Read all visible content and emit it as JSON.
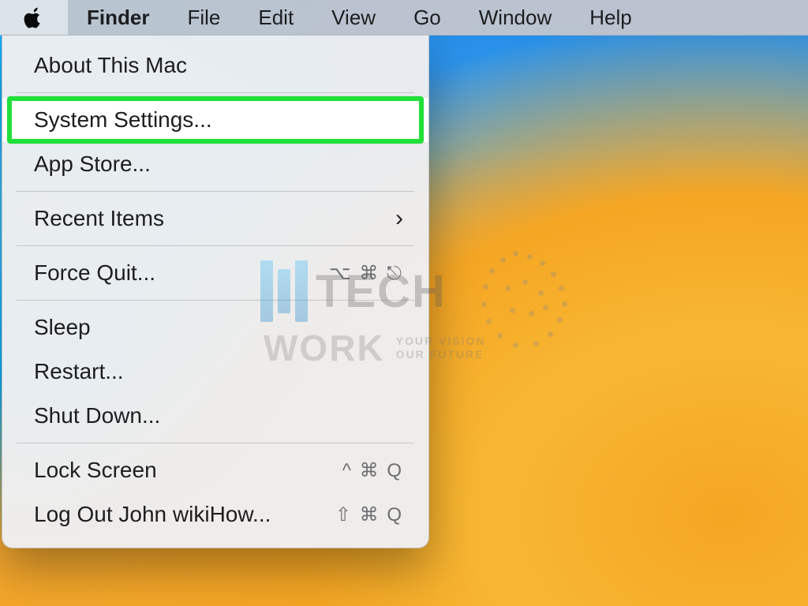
{
  "menubar": {
    "app_name": "Finder",
    "items": [
      {
        "label": "File"
      },
      {
        "label": "Edit"
      },
      {
        "label": "View"
      },
      {
        "label": "Go"
      },
      {
        "label": "Window"
      },
      {
        "label": "Help"
      }
    ]
  },
  "apple_menu": {
    "about": "About This Mac",
    "system_settings": "System Settings...",
    "app_store": "App Store...",
    "recent_items": "Recent Items",
    "force_quit": "Force Quit...",
    "force_quit_shortcut": "⌥ ⌘ ⎋",
    "sleep": "Sleep",
    "restart": "Restart...",
    "shut_down": "Shut Down...",
    "lock_screen": "Lock Screen",
    "lock_screen_shortcut": "^ ⌘ Q",
    "log_out": "Log Out John wikiHow...",
    "log_out_shortcut": "⇧ ⌘ Q"
  },
  "watermark": {
    "line1": "TECH",
    "line2": "WORK",
    "tag1": "YOUR VISION",
    "tag2": "OUR FUTURE"
  }
}
